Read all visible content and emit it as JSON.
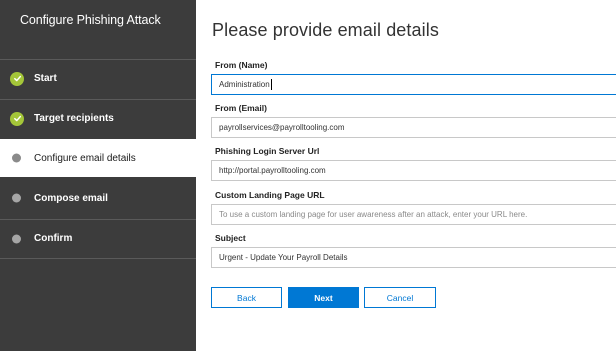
{
  "sidebar": {
    "title": "Configure Phishing Attack",
    "steps": [
      {
        "label": "Start",
        "state": "complete",
        "icon": "check-circle-icon"
      },
      {
        "label": "Target recipients",
        "state": "complete",
        "icon": "check-circle-icon"
      },
      {
        "label": "Configure email details",
        "state": "current",
        "icon": "dot-icon"
      },
      {
        "label": "Compose email",
        "state": "pending",
        "icon": "dot-icon"
      },
      {
        "label": "Confirm",
        "state": "pending",
        "icon": "dot-icon"
      }
    ]
  },
  "main": {
    "title": "Please provide email details",
    "fields": {
      "from_name": {
        "label": "From (Name)",
        "value": "Administration",
        "placeholder": ""
      },
      "from_email": {
        "label": "From (Email)",
        "value": "payrollservices@payrolltooling.com",
        "placeholder": ""
      },
      "login_server": {
        "label": "Phishing Login Server Url",
        "value": "http://portal.payrolltooling.com",
        "placeholder": ""
      },
      "landing_page": {
        "label": "Custom Landing Page URL",
        "value": "",
        "placeholder": "To use a custom landing page for user awareness after an attack, enter your URL here."
      },
      "subject": {
        "label": "Subject",
        "value": "Urgent - Update Your Payroll Details",
        "placeholder": ""
      }
    },
    "buttons": {
      "back": "Back",
      "next": "Next",
      "cancel": "Cancel"
    }
  },
  "colors": {
    "sidebar_bg": "#3c3c3c",
    "accent": "#0078d4",
    "complete": "#a4c639",
    "pending_dot": "#a6a6a6"
  }
}
